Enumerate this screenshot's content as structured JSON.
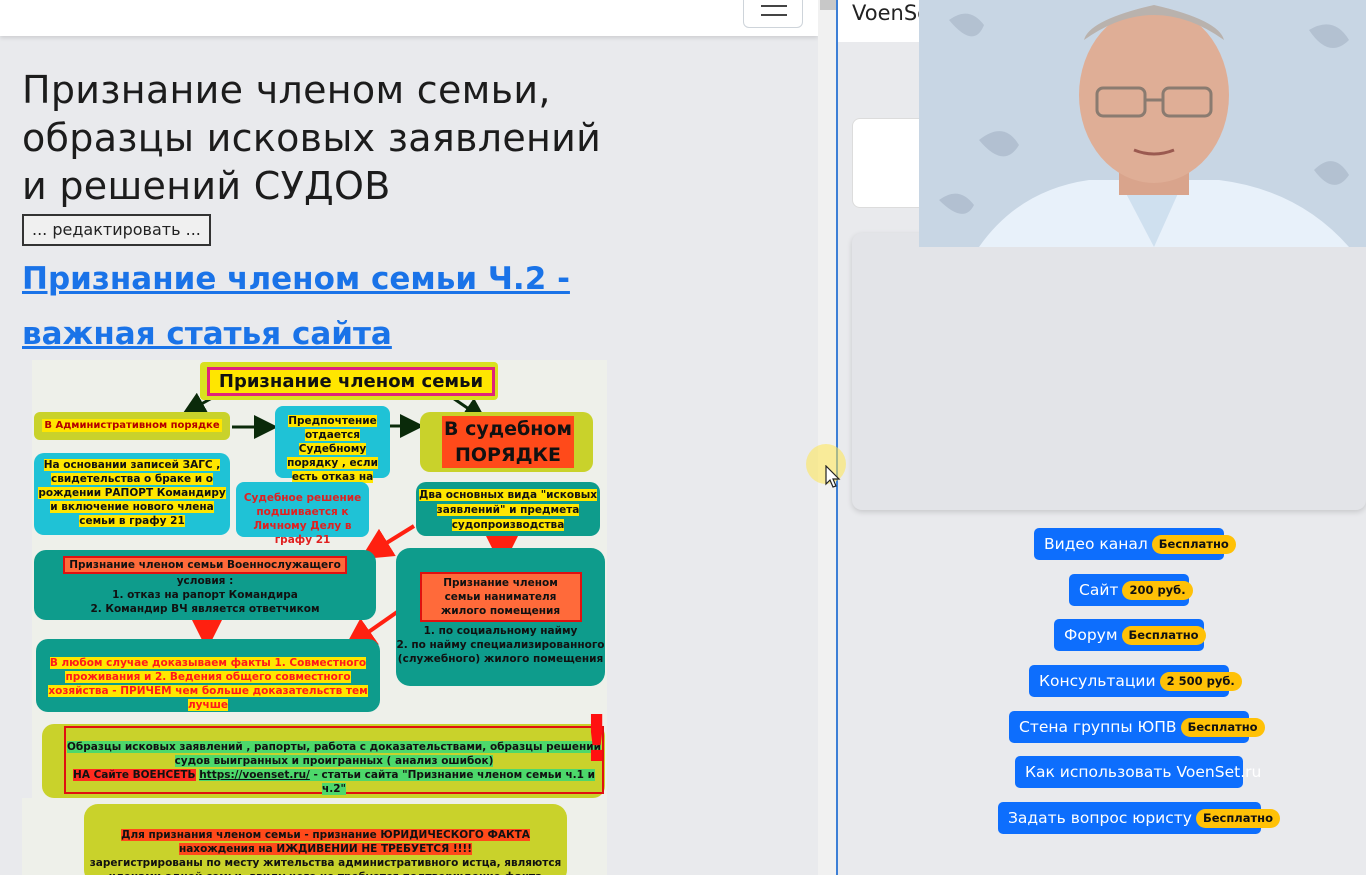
{
  "left": {
    "title": "Признание членом семьи, образцы исковых заявлений и решений СУДОВ",
    "edit_button": "... редактировать ...",
    "article_link": "Признание членом семьи Ч.2  - важная статья сайта"
  },
  "infographic": {
    "title": "Признание членом семьи",
    "admin": "В Административном порядке",
    "preference": "Предпочтение отдается Судебному порядку , если есть отказ на рапорт",
    "court": "В судебном ПОРЯДКЕ",
    "zags": "На основании записей ЗАГС , свидетельства о браке и о рождении РАПОРТ Командиру и включение нового члена семьи в графу 21",
    "decision": "Судебное решение подшивается к Личному Делу в графу 21",
    "two_types": "Два основных вида \"исковых заявлений\" и предмета судопроизводства",
    "serviceman_head": "Признание членом семьи Военнослужащего",
    "serviceman_body_1": "условия :",
    "serviceman_body_2": "1. отказ на рапорт Командира",
    "serviceman_body_3": "2. Командир ВЧ является ответчиком",
    "tenant_head": "Признание членом семьи нанимателя жилого помещения",
    "tenant_body_1": "1. по социальному найму",
    "tenant_body_2": "2. по найму специализированного (служебного) жилого помещения",
    "facts": "В любом случае доказываем факты 1. Совместного проживания и 2. Ведения общего совместного хозяйства - ПРИЧЕМ чем больше доказательств тем лучше",
    "samples_1": "Образцы исковых заявлений , рапорты, работа с доказательствами, образцы решений судов выигранных и проигранных ( анализ ошибок)",
    "samples_site": "НА Сайте ВОЕНСЕТЬ",
    "samples_url": "https://voenset.ru/",
    "samples_rest": " - статьи  сайта \"Признание членом семьи ч.1 и ч.2\"",
    "excl": "!",
    "dependency_head": "Для признания членом семьи - признание ЮРИДИЧЕСКОГО ФАКТА нахождения на ИЖДИВЕНИИ НЕ ТРЕБУЕТСЯ !!!!",
    "dependency_body": "зарегистрированы по месту жительства административного истца, являются членами одной семьи, ввиду чего не требуется подтверждение факта нахождения на иждивении"
  },
  "right": {
    "brand": "VoenSet",
    "pills": [
      {
        "label": "Видео канал",
        "badge": "Бесплатно"
      },
      {
        "label": "Сайт",
        "badge": "200 руб."
      },
      {
        "label": "Форум",
        "badge": "Бесплатно"
      },
      {
        "label": "Консультации",
        "badge": "2 500 руб."
      },
      {
        "label": "Стена группы ЮПВ",
        "badge": "Бесплатно"
      },
      {
        "label": "Как использовать VoenSet.ru",
        "badge": ""
      },
      {
        "label": "Задать вопрос юристу",
        "badge": "Бесплатно"
      }
    ]
  },
  "colors": {
    "link": "#1a73e8",
    "pill": "#0d6efd",
    "badge": "#ffc107",
    "divider": "#3d7fd6"
  },
  "icons": [
    "hamburger-menu-icon",
    "mouse-pointer-icon"
  ]
}
